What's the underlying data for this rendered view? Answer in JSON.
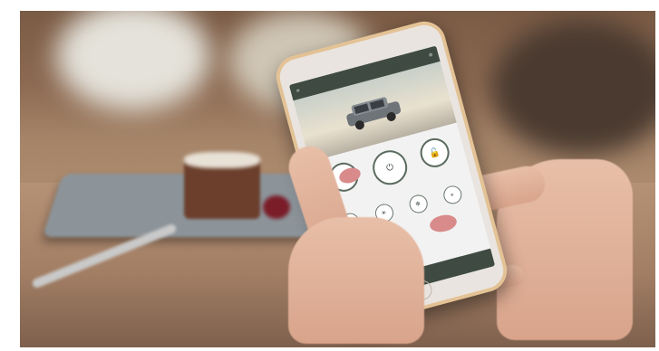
{
  "scene": {
    "description_icons": [
      "lock-icon",
      "engine-start-icon",
      "unlock-icon"
    ],
    "accent_color": "#2e8b57",
    "app_bar_color": "#3f4b42"
  },
  "app": {
    "title": "",
    "status_text": "",
    "small_buttons": [
      "",
      "",
      "",
      ""
    ]
  }
}
